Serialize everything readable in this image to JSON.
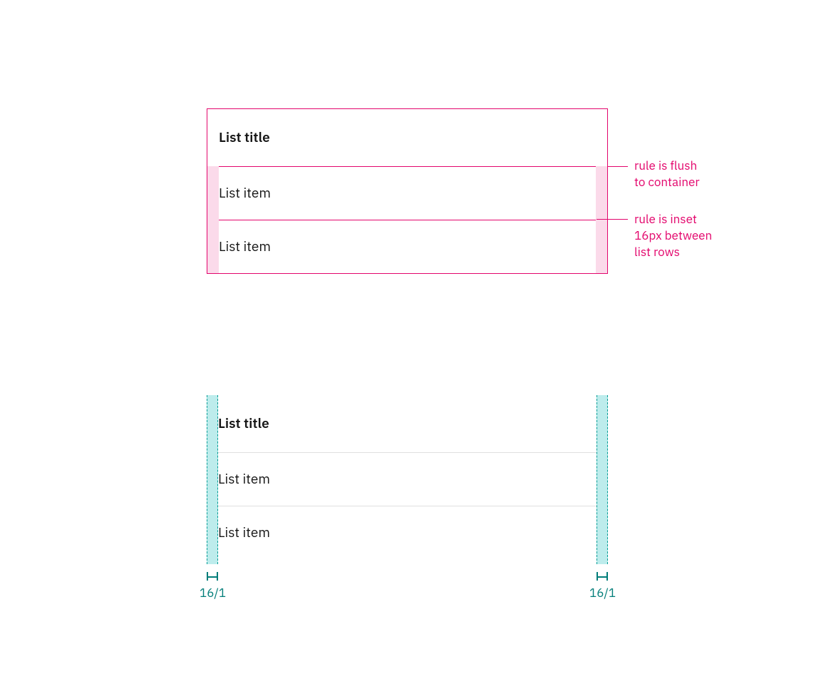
{
  "example1": {
    "title": "List title",
    "items": [
      "List item",
      "List item"
    ],
    "annotations": {
      "flush": "rule is flush\nto container",
      "inset": "rule is inset\n16px between\nlist rows"
    }
  },
  "example2": {
    "title": "List title",
    "items": [
      "List item",
      "List item"
    ],
    "spacers": {
      "left": "16/1",
      "right": "16/1"
    }
  },
  "colors": {
    "annotation": "#e3056c",
    "annotation_bg": "#fbdaea",
    "teal": "#007d79",
    "teal_bg": "#bdecec",
    "teal_dash": "#009c95",
    "text": "#161616",
    "rule_light": "#e0e0e0"
  }
}
